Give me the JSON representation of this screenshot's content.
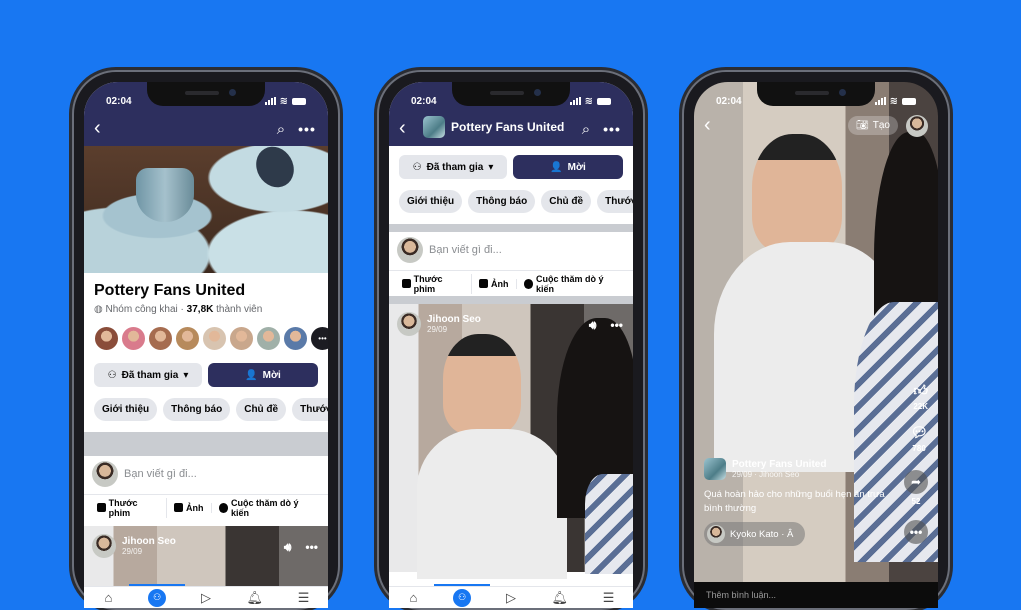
{
  "status_time": "02:04",
  "group": {
    "name": "Pottery Fans United",
    "privacy": "Nhóm công khai",
    "members_count": "37,8K",
    "members_suffix": "thành viên",
    "joined_label": "Đã tham gia",
    "invite_label": "Mời",
    "tabs": [
      "Giới thiệu",
      "Thông báo",
      "Chủ đề",
      "Thước p"
    ],
    "member_avatar_colors": [
      "#8a4d3a",
      "#d97b8c",
      "#a66c4f",
      "#b78a5c",
      "#d8c4b0",
      "#c9a78c",
      "#a0b0a8",
      "#5a7aa8"
    ]
  },
  "composer": {
    "placeholder": "Bạn viết gì đi...",
    "actions": [
      "Thước phim",
      "Ảnh",
      "Cuộc thăm dò ý kiến"
    ]
  },
  "post": {
    "author": "Jihoon Seo",
    "date": "29/09"
  },
  "tabbar": [
    "home",
    "groups",
    "video",
    "notifications",
    "menu"
  ],
  "reel": {
    "create_label": "Tạo",
    "group_name": "Pottery Fans United",
    "meta": "29/09 · Jihoon Seo",
    "caption": "Quá hoàn hảo cho những buổi hẹn ăn trưa bình thường",
    "audio": "Kyoko Kato · Â",
    "likes": "22K",
    "comments": "780",
    "shares": "52",
    "comment_placeholder": "Thêm bình luận..."
  },
  "colors": {
    "background": "#1877f2",
    "nav": "#2d2f5e",
    "accent": "#1877f2"
  }
}
